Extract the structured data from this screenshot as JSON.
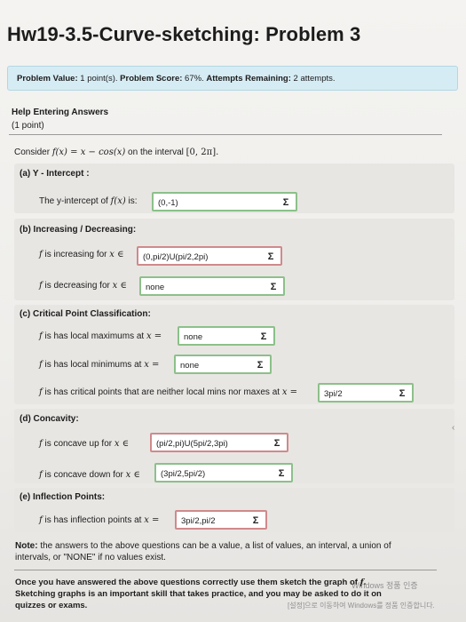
{
  "title": "Hw19-3.5-Curve-sketching: Problem 3",
  "problem_bar": {
    "value_label": "Problem Value:",
    "value": "1 point(s).",
    "score_label": "Problem Score:",
    "score": "67%.",
    "attempts_label": "Attempts Remaining:",
    "attempts": "2 attempts."
  },
  "help_link": "Help Entering Answers",
  "points": "(1 point)",
  "consider": {
    "prefix": "Consider",
    "fx": "f(x) = x − cos(x)",
    "mid": "on the interval",
    "interval": "[0, 2π]."
  },
  "parts": {
    "a": {
      "heading": "(a) Y - Intercept :",
      "prompt_pre": "The y-intercept of",
      "prompt_fx": "f(x)",
      "prompt_post": "is:",
      "answer": "(0,-1)"
    },
    "b": {
      "heading": "(b) Increasing / Decreasing:",
      "inc_f": "f",
      "inc_text": "is increasing for",
      "inc_math": "x ∈",
      "inc_answer": "(0,pi/2)U(pi/2,2pi)",
      "dec_f": "f",
      "dec_text": "is decreasing for",
      "dec_math": "x ∈",
      "dec_answer": "none"
    },
    "c": {
      "heading": "(c) Critical Point Classification:",
      "max_f": "f",
      "max_text": "is has local maximums at",
      "max_math": "x =",
      "max_answer": "none",
      "min_f": "f",
      "min_text": "is has local minimums at",
      "min_math": "x =",
      "min_answer": "none",
      "crit_f": "f",
      "crit_text": "is has critical points that are neither local mins nor maxes at",
      "crit_math": "x =",
      "crit_answer": "3pi/2"
    },
    "d": {
      "heading": "(d) Concavity:",
      "up_f": "f",
      "up_text": "is concave up for",
      "up_math": "x ∈",
      "up_answer": "(pi/2,pi)U(5pi/2,3pi)",
      "down_f": "f",
      "down_text": "is concave down for",
      "down_math": "x ∈",
      "down_answer": "(3pi/2,5pi/2)"
    },
    "e": {
      "heading": "(e) Inflection Points:",
      "inf_f": "f",
      "inf_text": "is has inflection points at",
      "inf_math": "x =",
      "inf_answer": "3pi/2,pi/2"
    }
  },
  "note": {
    "label": "Note:",
    "line1": "the answers to the above questions can be a value, a list of values, an interval, a union of",
    "line2": "intervals, or \"NONE\" if no values exist."
  },
  "footer": {
    "line1_pre": "Once you have answered the above questions correctly use them sketch the graph of",
    "line1_f": "f.",
    "line2": "Sketching graphs is an important skill that takes practice, and you may be asked to do it on",
    "line3": "quizzes or exams."
  },
  "watermark": {
    "line1": "Windows 정품 인증",
    "line2": "[설정]으로 이동하여 Windows를 정품 인증합니다."
  },
  "sigma_symbol": "Σ",
  "colors": {
    "correct_border": "#8cc08a",
    "incorrect_border": "#cf8a8c",
    "info_bar": "#d6ecf4"
  }
}
